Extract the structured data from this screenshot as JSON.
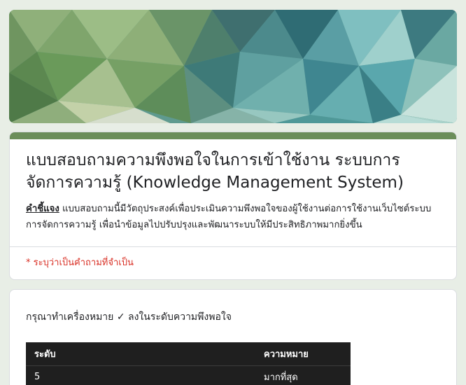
{
  "header": {
    "banner_image": "low-poly-green-teal-banner",
    "accent_color": "#6b8e5a"
  },
  "form": {
    "title": "แบบสอบถามความพึงพอใจในการเข้าใช้งาน ระบบการจัดการความรู้ (Knowledge Management System)",
    "description_lead": "คำชี้แจง",
    "description": " แบบสอบถามนี้มีวัตถุประสงค์เพื่อประเมินความพึงพอใจของผู้ใช้งานต่อการใช้งานเว็บไซต์ระบบการจัดการความรู้ เพื่อนำข้อมูลไปปรับปรุงและพัฒนาระบบให้มีประสิทธิภาพมากยิ่งขึ้น",
    "required_note": "* ระบุว่าเป็นคำถามที่จำเป็น",
    "required_color": "#d93025"
  },
  "question": {
    "text": "กรุณาทำเครื่องหมาย ✓ ลงในระดับความพึงพอใจ",
    "table": {
      "headers": [
        "ระดับ",
        "ความหมาย"
      ],
      "rows": [
        [
          "5",
          "มากที่สุด"
        ]
      ]
    }
  }
}
